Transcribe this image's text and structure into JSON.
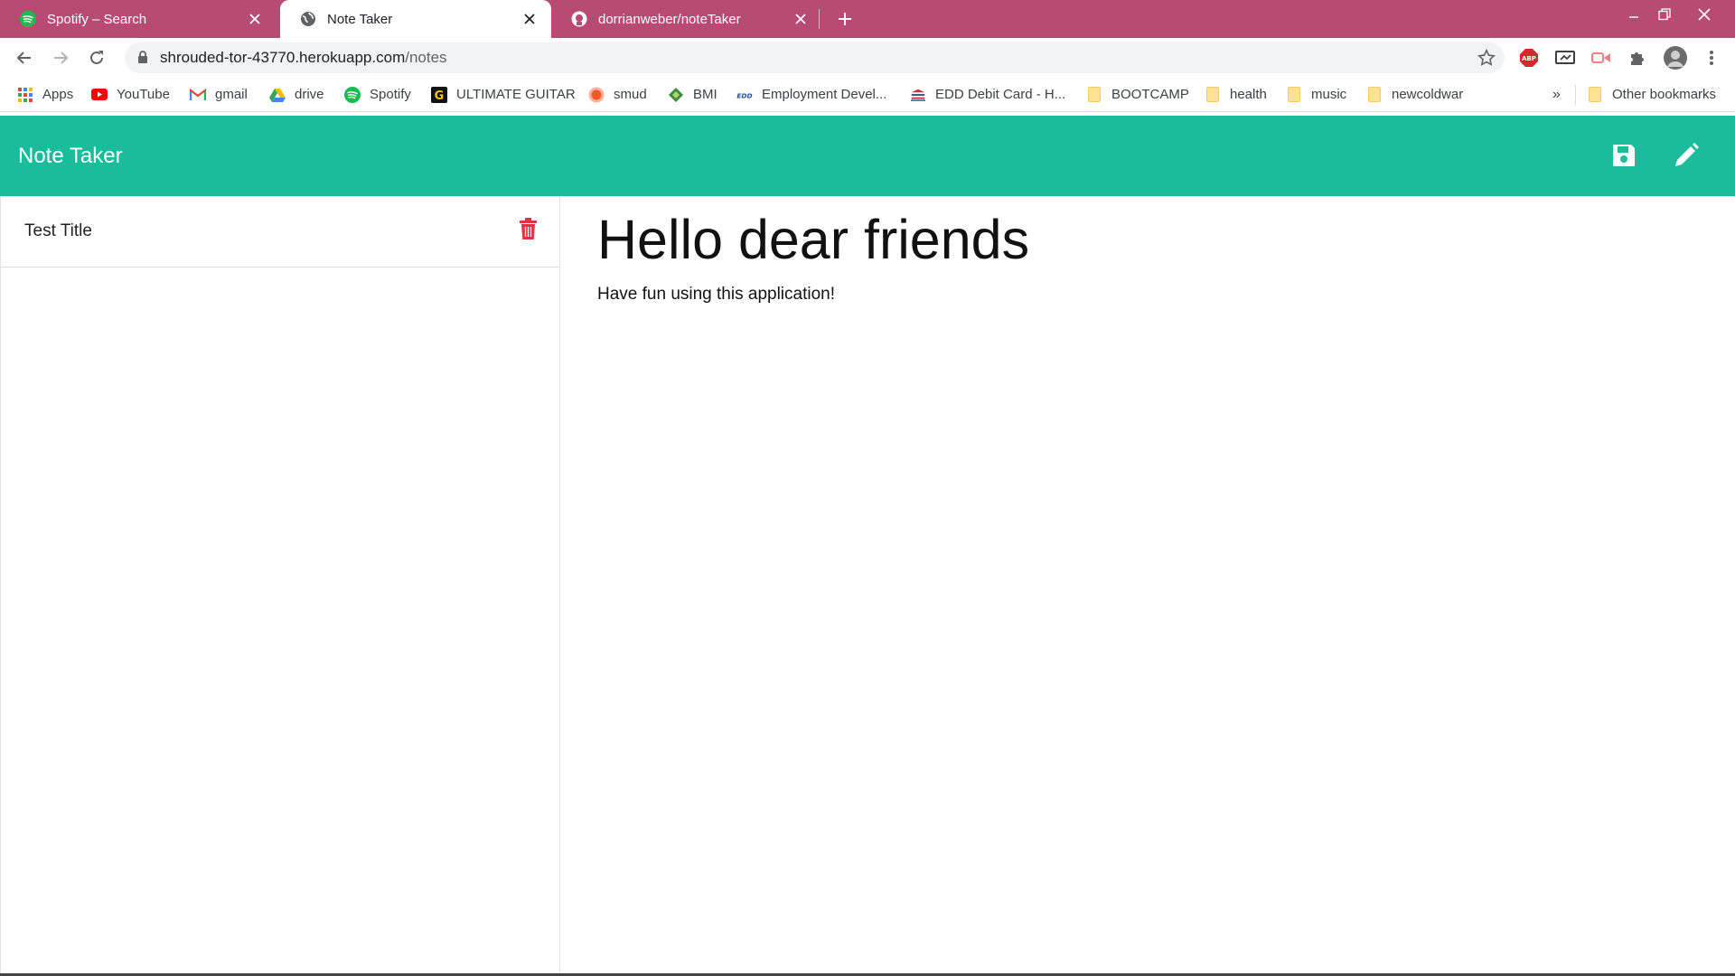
{
  "browser": {
    "tabs": [
      {
        "title": "Spotify – Search",
        "favicon": "spotify-icon",
        "active": false
      },
      {
        "title": "Note Taker",
        "favicon": "globe-icon",
        "active": true
      },
      {
        "title": "dorrianweber/noteTaker",
        "favicon": "github-icon",
        "active": false
      }
    ],
    "url_host": "shrouded-tor-43770.herokuapp.com",
    "url_path": "/notes",
    "bookmarks": [
      {
        "label": "Apps",
        "icon": "apps-grid-icon"
      },
      {
        "label": "YouTube",
        "icon": "youtube-icon"
      },
      {
        "label": "gmail",
        "icon": "gmail-icon"
      },
      {
        "label": "drive",
        "icon": "drive-icon"
      },
      {
        "label": "Spotify",
        "icon": "spotify-icon"
      },
      {
        "label": "ULTIMATE GUITAR",
        "icon": "ultimate-guitar-icon"
      },
      {
        "label": "smud",
        "icon": "smud-icon"
      },
      {
        "label": "BMI",
        "icon": "bmi-icon"
      },
      {
        "label": "Employment Devel...",
        "icon": "edd-icon"
      },
      {
        "label": "EDD Debit Card - H...",
        "icon": "bank-icon"
      },
      {
        "label": "BOOTCAMP",
        "icon": "folder-icon"
      },
      {
        "label": "health",
        "icon": "folder-icon"
      },
      {
        "label": "music",
        "icon": "folder-icon"
      },
      {
        "label": "newcoldwar",
        "icon": "folder-icon"
      }
    ],
    "overflow_label": "»",
    "other_bookmarks": "Other bookmarks"
  },
  "app": {
    "brand": "Note Taker",
    "accent_color": "#1abc9c",
    "delete_color": "#dc3545",
    "notes": [
      {
        "title": "Test Title"
      }
    ],
    "active_note": {
      "title": "Hello dear friends",
      "text": "Have fun using this application!"
    }
  }
}
